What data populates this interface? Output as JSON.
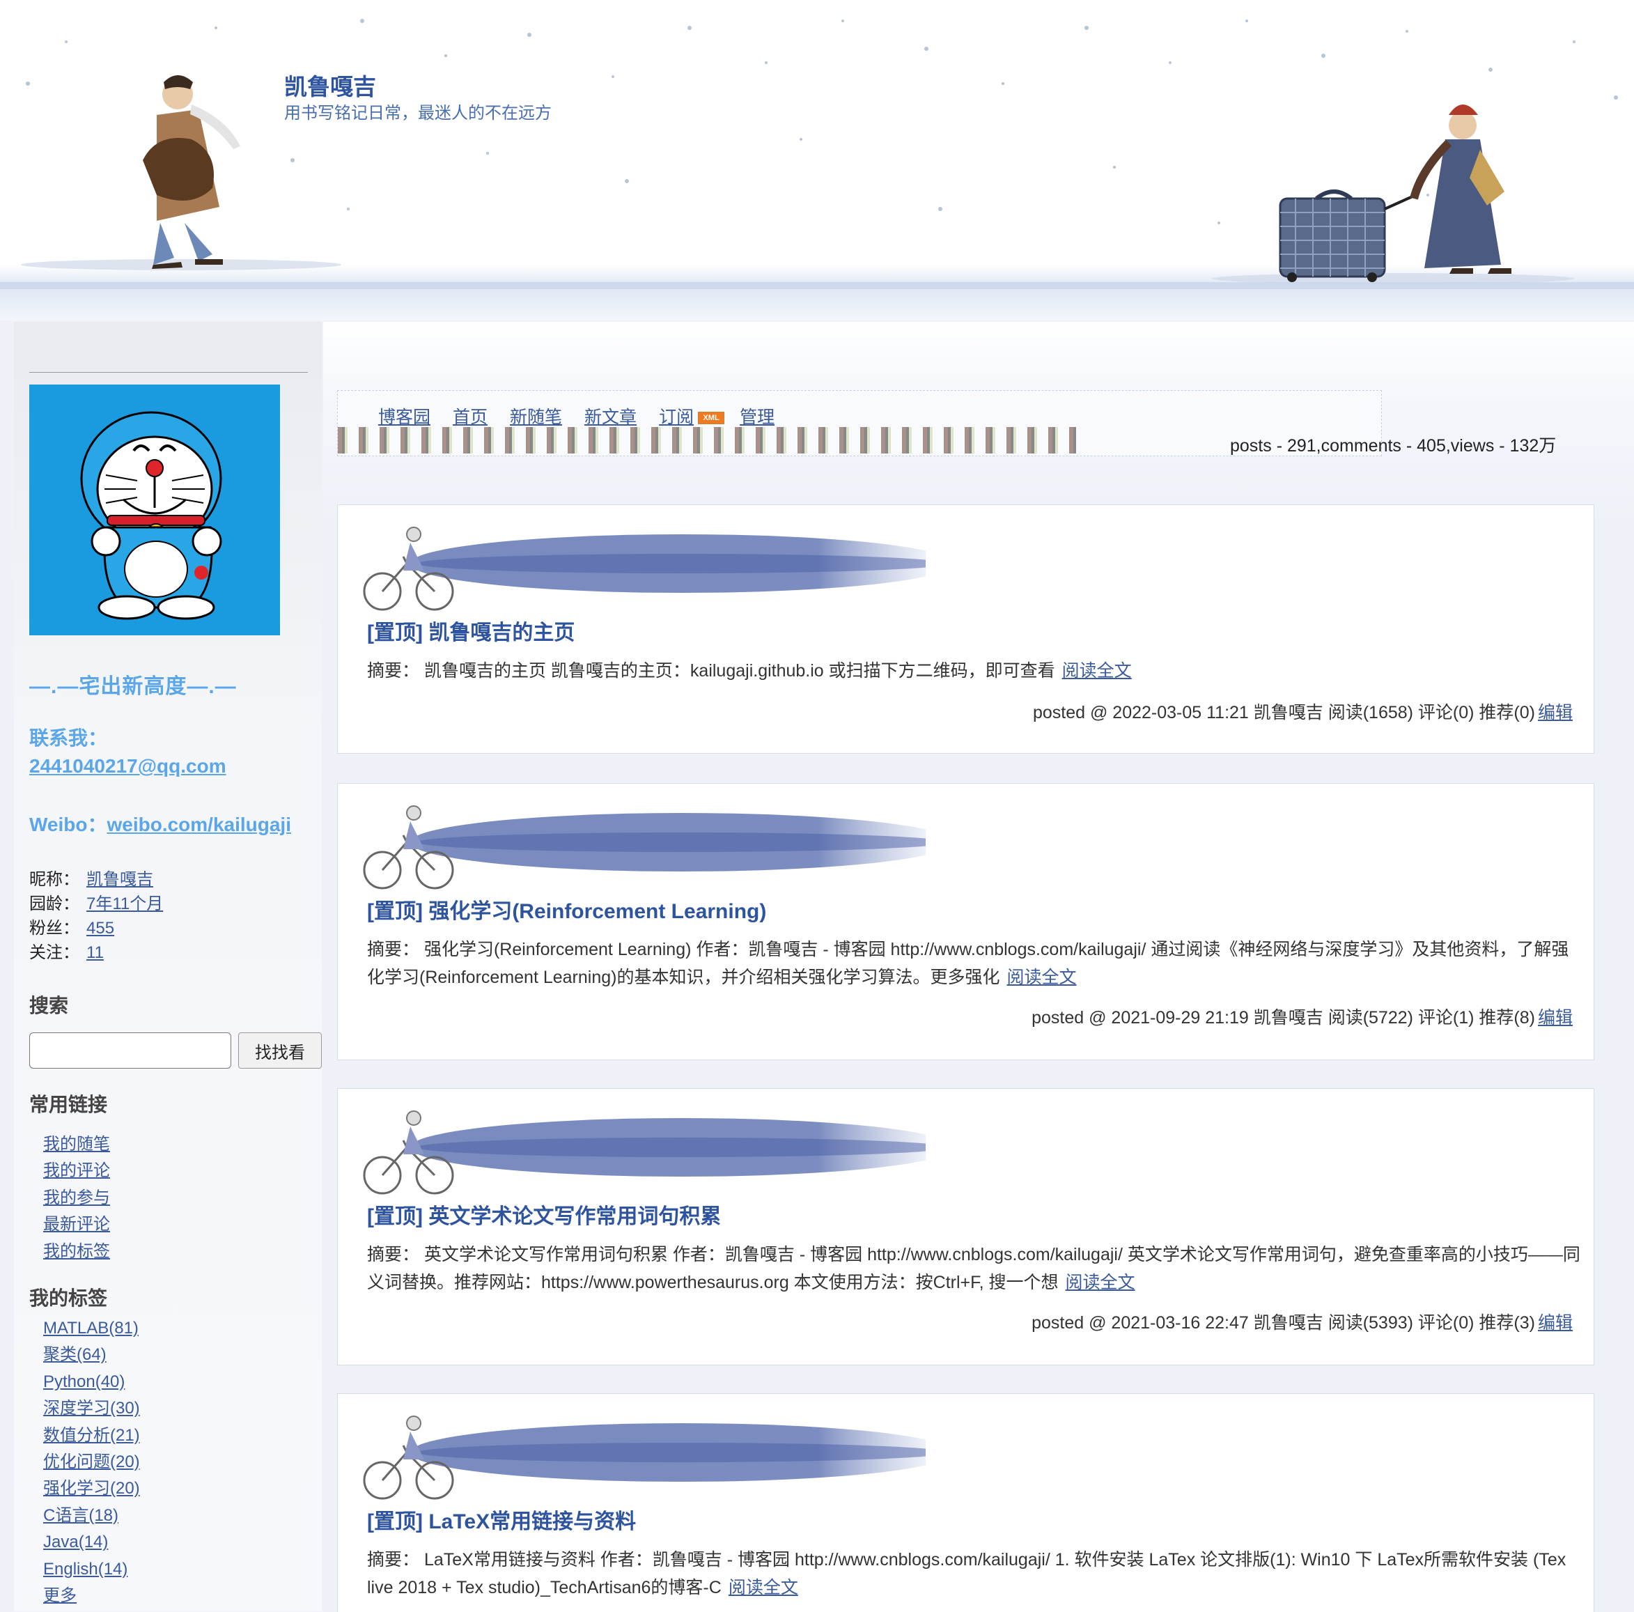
{
  "header": {
    "title": "凯鲁嘎吉",
    "subtitle": "用书写铭记日常，最迷人的不在远方"
  },
  "sidebar": {
    "motto": "—.—宅出新高度—.—",
    "contact_label": "联系我：",
    "contact_email": "2441040217@qq.com",
    "weibo_label": "Weibo：",
    "weibo_link": "weibo.com/kailugaji",
    "info": [
      {
        "label": "昵称：",
        "value": "凯鲁嘎吉"
      },
      {
        "label": "园龄：",
        "value": "7年11个月"
      },
      {
        "label": "粉丝：",
        "value": "455"
      },
      {
        "label": "关注：",
        "value": "11"
      }
    ],
    "search": {
      "heading": "搜索",
      "button": "找找看",
      "placeholder": ""
    },
    "links_heading": "常用链接",
    "links": [
      "我的随笔",
      "我的评论",
      "我的参与",
      "最新评论",
      "我的标签"
    ],
    "tags_heading": "我的标签",
    "tags": [
      "MATLAB(81)",
      "聚类(64)",
      "Python(40)",
      "深度学习(30)",
      "数值分析(21)",
      "优化问题(20)",
      "强化学习(20)",
      "C语言(18)",
      "Java(14)",
      "English(14)",
      "更多"
    ]
  },
  "nav": {
    "items": [
      "博客园",
      "首页",
      "新随笔",
      "新文章",
      "订阅",
      "管理"
    ],
    "rss_badge": "XML",
    "stats": "posts - 291,comments - 405,views - 132万"
  },
  "posts": [
    {
      "title": "[置顶] 凯鲁嘎吉的主页",
      "summary_label": "摘要：",
      "summary": "凯鲁嘎吉的主页 凯鲁嘎吉的主页：kailugaji.github.io 或扫描下方二维码，即可查看",
      "read_more": "阅读全文",
      "meta": "posted @ 2022-03-05 11:21 凯鲁嘎吉 阅读(1658) 评论(0) 推荐(0)",
      "edit": "编辑"
    },
    {
      "title": "[置顶] 强化学习(Reinforcement Learning)",
      "summary_label": "摘要：",
      "summary": "强化学习(Reinforcement Learning) 作者：凯鲁嘎吉 - 博客园 http://www.cnblogs.com/kailugaji/ 通过阅读《神经网络与深度学习》及其他资料，了解强化学习(Reinforcement Learning)的基本知识，并介绍相关强化学习算法。更多强化",
      "read_more": "阅读全文",
      "meta": "posted @ 2021-09-29 21:19 凯鲁嘎吉 阅读(5722) 评论(1) 推荐(8)",
      "edit": "编辑"
    },
    {
      "title": "[置顶] 英文学术论文写作常用词句积累",
      "summary_label": "摘要：",
      "summary": "英文学术论文写作常用词句积累 作者：凯鲁嘎吉 - 博客园 http://www.cnblogs.com/kailugaji/ 英文学术论文写作常用词句，避免查重率高的小技巧——同义词替换。推荐网站：https://www.powerthesaurus.org 本文使用方法：按Ctrl+F, 搜一个想",
      "read_more": "阅读全文",
      "meta": "posted @ 2021-03-16 22:47 凯鲁嘎吉 阅读(5393) 评论(0) 推荐(3)",
      "edit": "编辑"
    },
    {
      "title": "[置顶] LaTeX常用链接与资料",
      "summary_label": "摘要：",
      "summary": "LaTeX常用链接与资料 作者：凯鲁嘎吉 - 博客园 http://www.cnblogs.com/kailugaji/ 1. 软件安装 LaTex 论文排版(1): Win10 下 LaTex所需软件安装 (Tex live 2018 + Tex studio)_TechArtisan6的博客-C",
      "read_more": "阅读全文"
    }
  ]
}
